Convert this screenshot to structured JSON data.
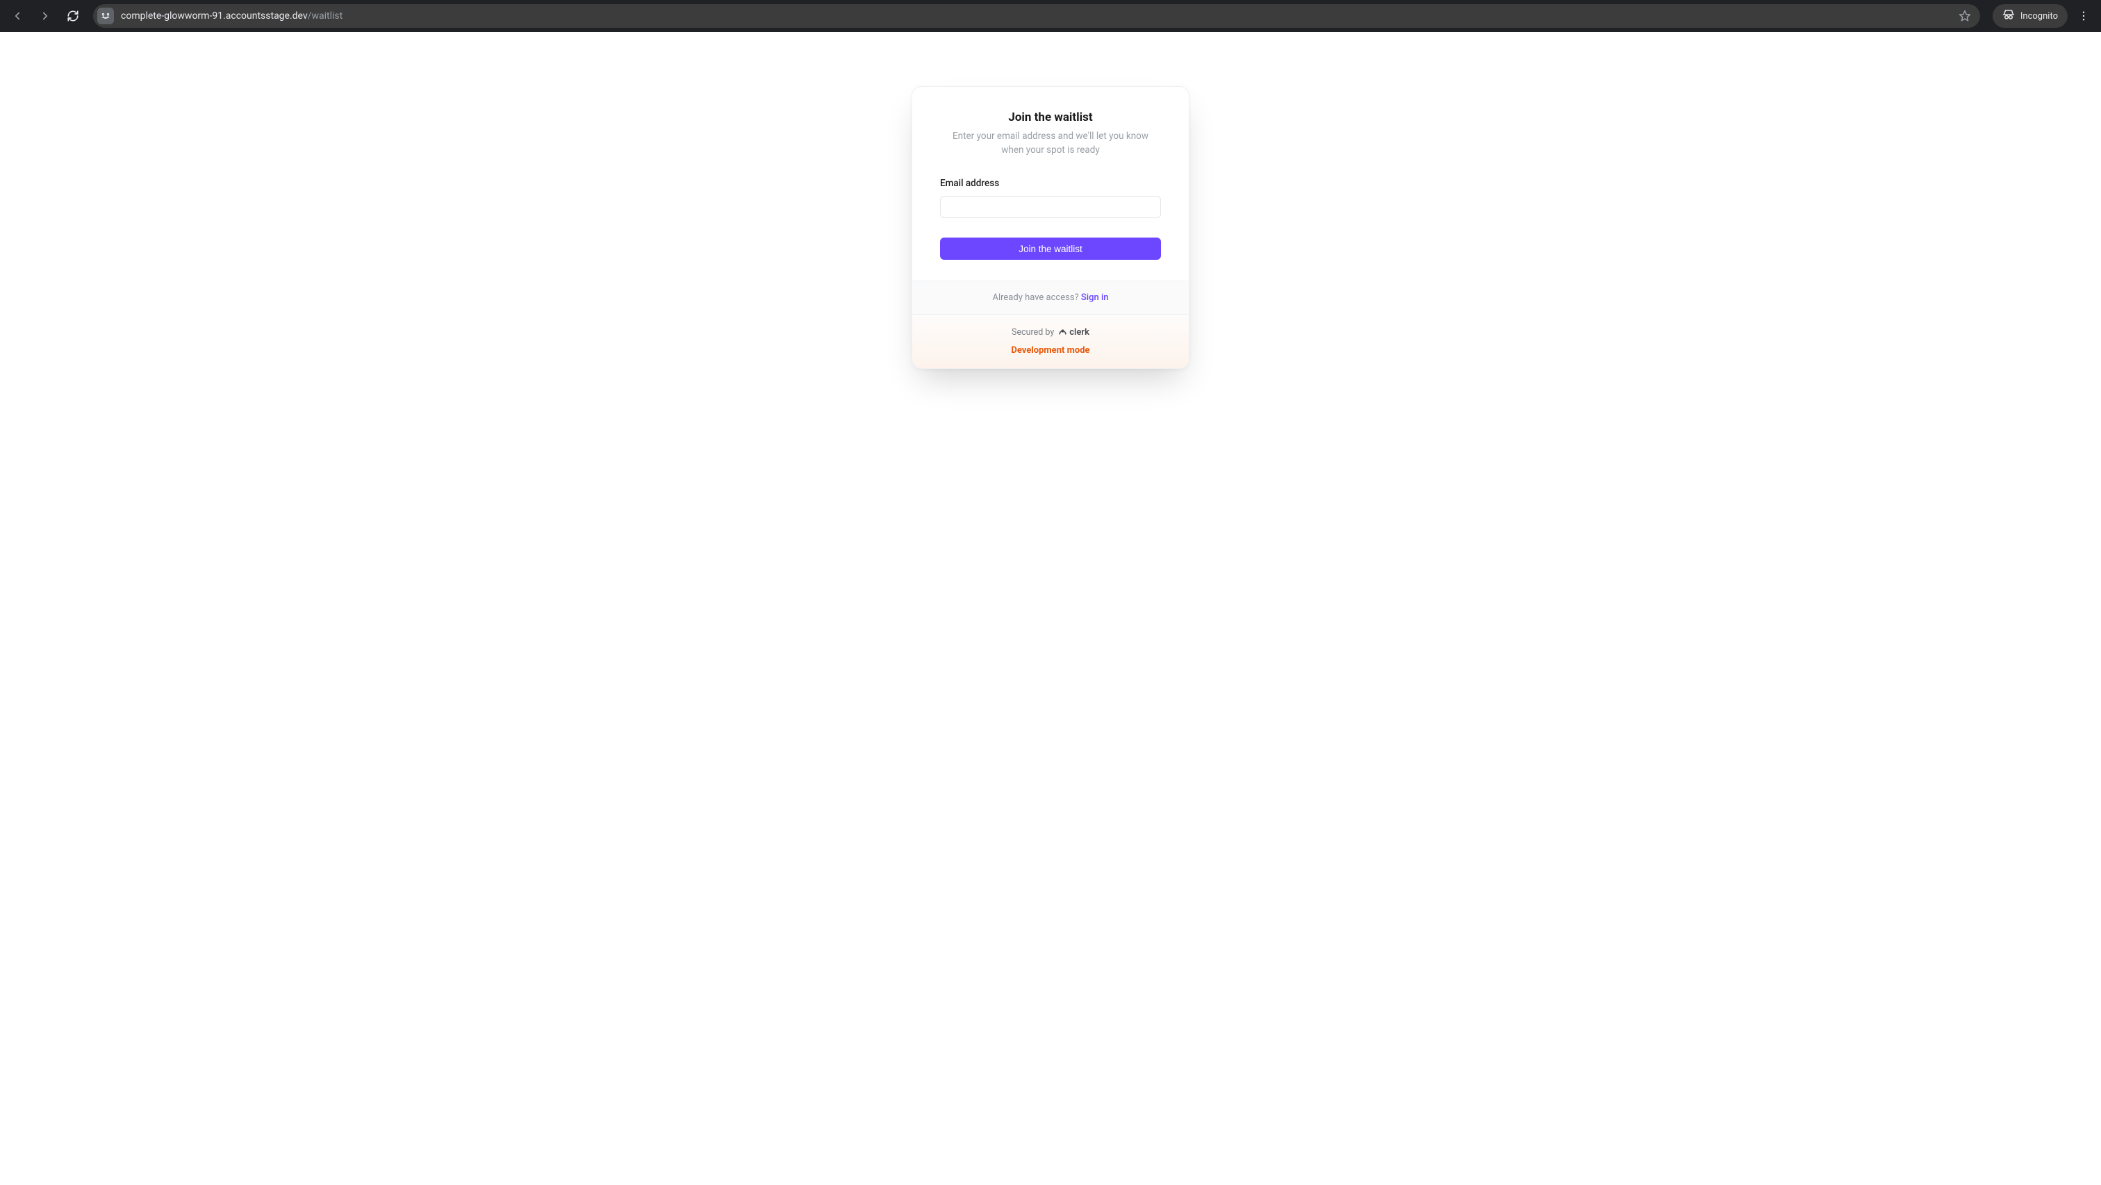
{
  "browser": {
    "url_host": "complete-glowworm-91.accountsstage.dev",
    "url_path": "/waitlist",
    "incognito_label": "Incognito"
  },
  "card": {
    "title": "Join the waitlist",
    "subtitle": "Enter your email address and we'll let you know when your spot is ready",
    "email_label": "Email address",
    "email_value": "",
    "submit_label": "Join the waitlist"
  },
  "footer": {
    "access_prompt": "Already have access? ",
    "signin_label": "Sign in",
    "secured_by": "Secured by",
    "brand": "clerk",
    "dev_mode": "Development mode"
  }
}
